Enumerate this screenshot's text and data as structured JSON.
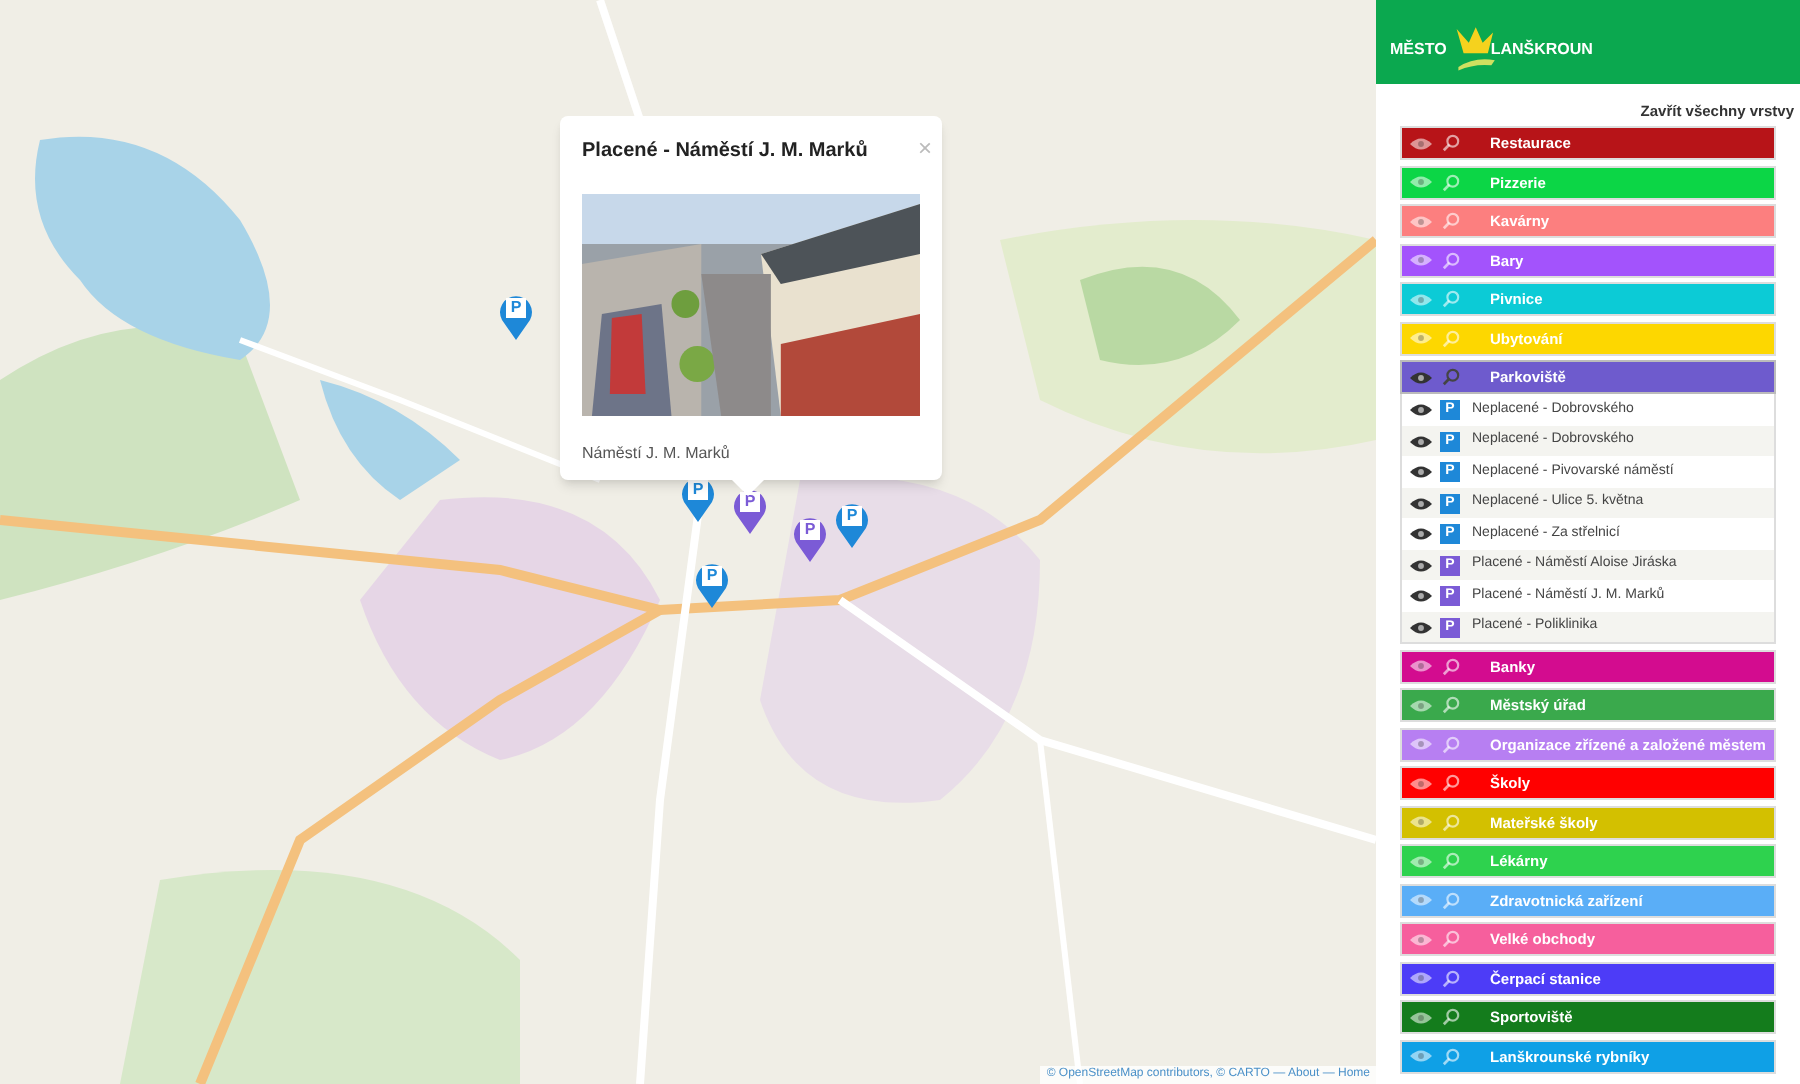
{
  "map": {
    "kind": "picture",
    "attribution": "© OpenStreetMap contributors, © CARTO — About — Home",
    "markers": [
      {
        "label": "P",
        "kind": "free"
      },
      {
        "label": "P",
        "kind": "free"
      },
      {
        "label": "P",
        "kind": "free"
      },
      {
        "label": "P",
        "kind": "paid"
      },
      {
        "label": "P",
        "kind": "paid"
      },
      {
        "label": "P",
        "kind": "free"
      }
    ],
    "popup": {
      "title": "Placené - Náměstí J. M. Marků",
      "caption": "Náměstí J. M. Marků",
      "close": "×"
    }
  },
  "panel": {
    "logo": {
      "left": "MĚSTO",
      "right": "LANŠKROUN"
    },
    "close_all": "Zavřít všechny vrstvy",
    "layers": [
      {
        "label": "Restaurace",
        "color": "#b71418",
        "visible": false,
        "expanded": false
      },
      {
        "label": "Pizzerie",
        "color": "#0cd646",
        "visible": false,
        "expanded": false
      },
      {
        "label": "Kavárny",
        "color": "#fc7f7f",
        "visible": false,
        "expanded": false
      },
      {
        "label": "Bary",
        "color": "#a353fc",
        "visible": false,
        "expanded": false
      },
      {
        "label": "Pivnice",
        "color": "#0ccbd6",
        "visible": false,
        "expanded": false
      },
      {
        "label": "Ubytování",
        "color": "#fdd700",
        "visible": false,
        "expanded": false
      },
      {
        "label": "Parkoviště",
        "color": "#6e5bcd",
        "visible": true,
        "expanded": true,
        "children": [
          {
            "label": "Neplacené - Dobrovského",
            "icon": "P",
            "color": "#1e88d8"
          },
          {
            "label": "Neplacené - Dobrovského",
            "icon": "P",
            "color": "#1e88d8"
          },
          {
            "label": "Neplacené - Pivovarské náměstí",
            "icon": "P",
            "color": "#1e88d8"
          },
          {
            "label": "Neplacené - Ulice 5. května",
            "icon": "P",
            "color": "#1e88d8"
          },
          {
            "label": "Neplacené - Za střelnicí",
            "icon": "P",
            "color": "#1e88d8"
          },
          {
            "label": "Placené - Náměstí Aloise Jiráska",
            "icon": "P",
            "color": "#7b5bd6"
          },
          {
            "label": "Placené - Náměstí J. M. Marků",
            "icon": "P",
            "color": "#7b5bd6"
          },
          {
            "label": "Placené - Poliklinika",
            "icon": "P",
            "color": "#7b5bd6"
          }
        ]
      },
      {
        "label": "Banky",
        "color": "#d30c8f",
        "visible": false,
        "expanded": false
      },
      {
        "label": "Městský úřad",
        "color": "#3aa94c",
        "visible": false,
        "expanded": false
      },
      {
        "label": "Organizace zřízené a založené městem",
        "color": "#b77ff2",
        "visible": false,
        "expanded": false
      },
      {
        "label": "Školy",
        "color": "#ff0000",
        "visible": false,
        "expanded": false
      },
      {
        "label": "Mateřské školy",
        "color": "#d3c000",
        "visible": false,
        "expanded": false
      },
      {
        "label": "Lékárny",
        "color": "#2ed24e",
        "visible": false,
        "expanded": false
      },
      {
        "label": "Zdravotnická zařízení",
        "color": "#5aaef7",
        "visible": false,
        "expanded": false
      },
      {
        "label": "Velké obchody",
        "color": "#f65f9d",
        "visible": false,
        "expanded": false
      },
      {
        "label": "Čerpací stanice",
        "color": "#4d3cf7",
        "visible": false,
        "expanded": false
      },
      {
        "label": "Sportoviště",
        "color": "#147c1c",
        "visible": false,
        "expanded": false
      },
      {
        "label": "Lanškrounské rybníky",
        "color": "#0fa0e6",
        "visible": false,
        "expanded": false
      }
    ]
  }
}
